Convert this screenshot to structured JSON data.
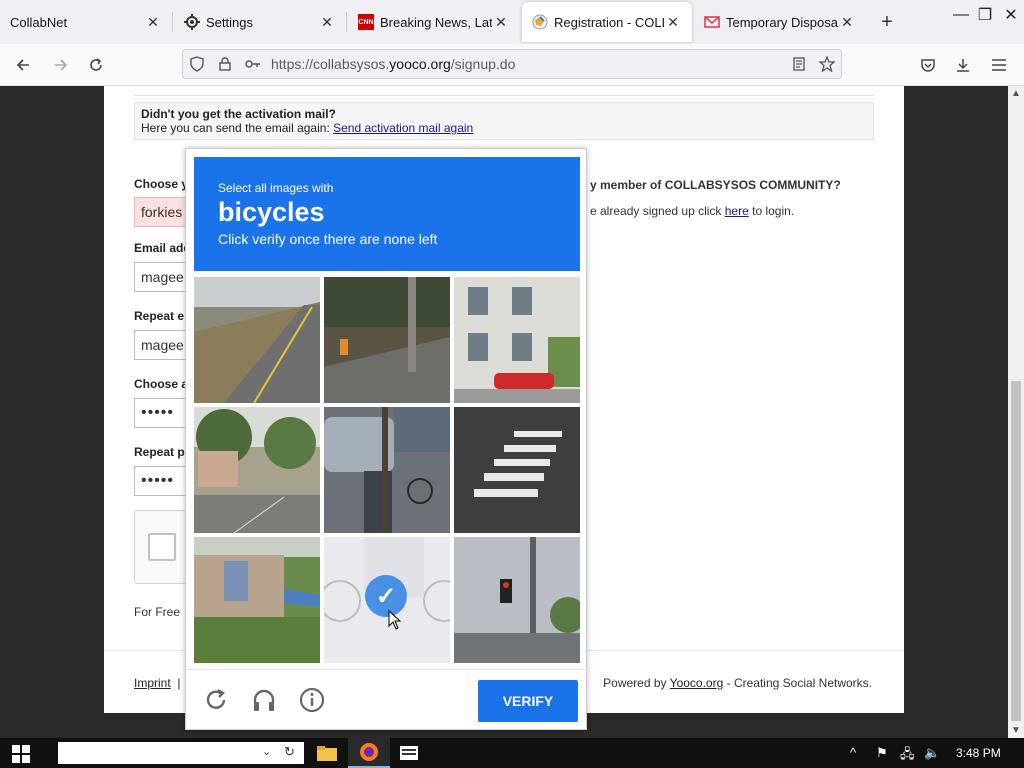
{
  "browser": {
    "tabs": [
      {
        "title": "CollabNet",
        "active": false
      },
      {
        "title": "Settings",
        "active": false
      },
      {
        "title": "Breaking News, Latest",
        "active": false
      },
      {
        "title": "Registration - COLLAB",
        "active": true
      },
      {
        "title": "Temporary Disposable",
        "active": false
      }
    ],
    "url_prefix": "https://collabsysos.",
    "url_domain": "yooco.org",
    "url_path": "/signup.do"
  },
  "page": {
    "activation_heading": "Didn't you get the activation mail?",
    "activation_text": "Here you can send the email again: ",
    "activation_link": "Send activation mail again",
    "choose_username_label": "Choose y",
    "username_value": "forkies",
    "email_label": "Email add",
    "email_value": "magee",
    "repeat_email_label": "Repeat e",
    "repeat_email_value": "magee",
    "choose_password_label": "Choose a",
    "password_value": "•••••",
    "repeat_password_label": "Repeat p",
    "repeat_password_value": "•••••",
    "for_free": "For Free",
    "member_heading": "y member of COLLABSYSOS COMMUNITY?",
    "signed_up_text": "e already signed up click ",
    "here_link": "here",
    "to_login": " to login.",
    "footer_imprint": "Imprint",
    "footer_sep": "|",
    "powered_by": "Powered by ",
    "powered_link": "Yooco.org",
    "powered_suffix": " - Creating Social Networks."
  },
  "captcha": {
    "instruction_line1": "Select all images with",
    "target": "bicycles",
    "instruction_line3": "Click verify once there are none left",
    "verify_label": "VERIFY",
    "selected_tile": 7
  },
  "taskbar": {
    "time": "3:48 PM"
  },
  "colors": {
    "captcha_blue": "#1a73e8",
    "error_field": "#fde0e0"
  }
}
